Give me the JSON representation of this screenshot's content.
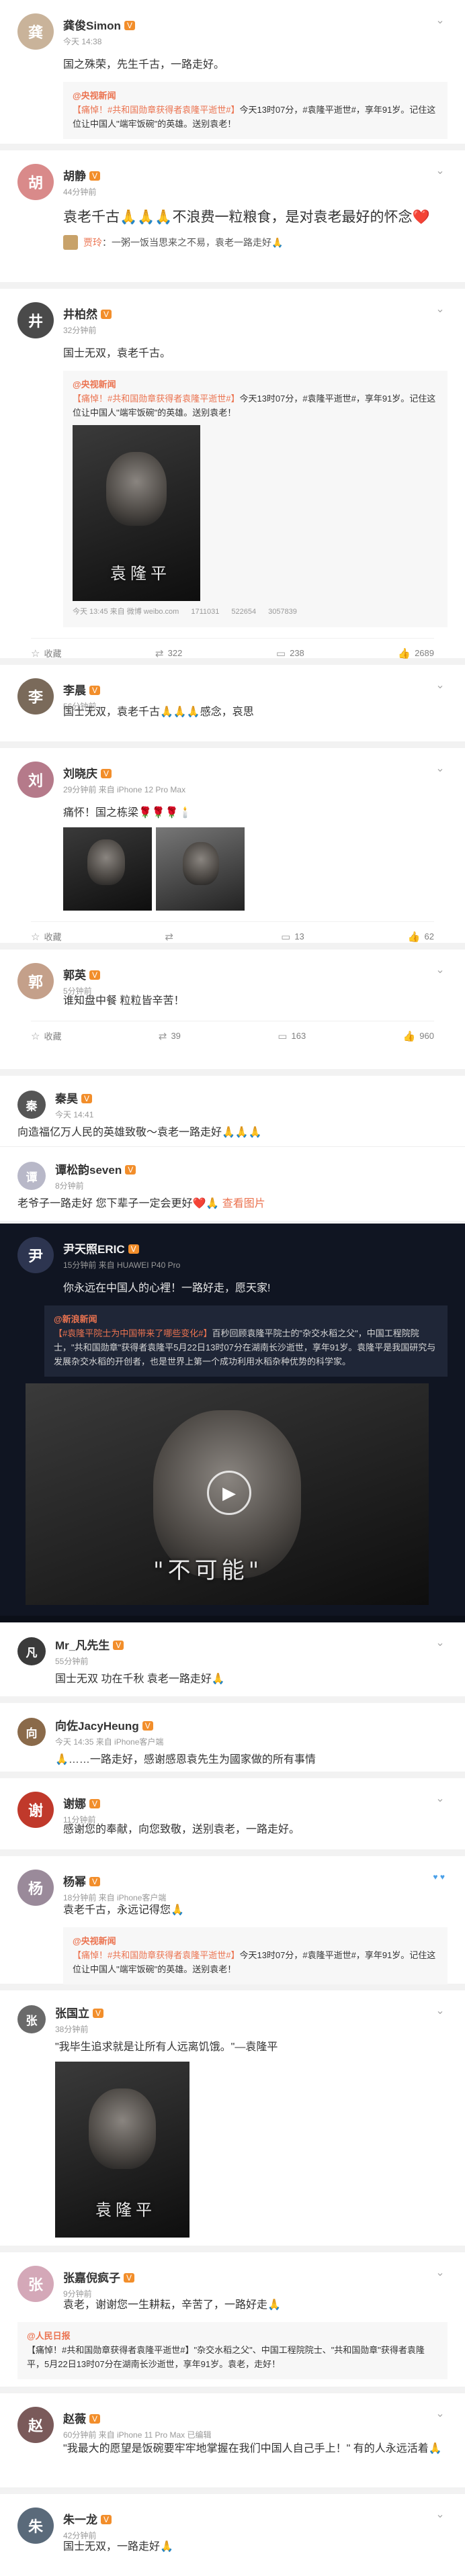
{
  "p1": {
    "name": "龚俊Simon",
    "meta": "今天 14:38",
    "text": "国之殊荣，先生千古，一路走好。",
    "q_name": "@央视新闻",
    "q_tag": "【痛悼！#共和国勋章获得者袁隆平逝世#】",
    "q_body": "今天13时07分，#袁隆平逝世#，享年91岁。记住这位让中国人\"端牢饭碗\"的英雄。送别袁老！"
  },
  "p2": {
    "name": "胡静",
    "meta": "44分钟前",
    "text": "袁老千古🙏🙏🙏不浪费一粒粮食，是对袁老最好的怀念❤️",
    "reply_name": "贾玲",
    "reply": "一粥一饭当思来之不易，袁老一路走好🙏"
  },
  "p3": {
    "name": "井柏然",
    "meta": "32分钟前",
    "text": "国士无双，袁老千古。",
    "q_name": "@央视新闻",
    "q_tag": "【痛悼！#共和国勋章获得者袁隆平逝世#】",
    "q_body": "今天13时07分，#袁隆平逝世#，享年91岁。记住这位让中国人\"端牢饭碗\"的英雄。送别袁老！",
    "q_caption": "袁隆平",
    "q_meta": [
      "今天 13:45 来自 微博 weibo.com",
      "1711031",
      "522654",
      "3057839"
    ],
    "actions": [
      "收藏",
      "322",
      "238",
      "2689"
    ]
  },
  "p4": {
    "name": "李晨",
    "meta": "56分钟前",
    "text": "国士无双，袁老千古🙏🙏🙏感念，哀思"
  },
  "p5": {
    "name": "刘晓庆",
    "meta": "29分钟前 来自 iPhone 12 Pro Max",
    "text": "痛怀！国之栋梁🌹🌹🌹🕯️",
    "actions": [
      "收藏",
      "",
      "13",
      "62"
    ]
  },
  "p6": {
    "name": "郭英",
    "meta": "5分钟前",
    "text": "谁知盘中餐 粒粒皆辛苦！",
    "actions": [
      "收藏",
      "39",
      "163",
      "960"
    ]
  },
  "p7": {
    "name": "秦昊",
    "meta": "今天 14:41",
    "text": "向造福亿万人民的英雄致敬～袁老一路走好🙏🙏🙏"
  },
  "p8": {
    "name": "谭松韵seven",
    "meta": "8分钟前",
    "text": "老爷子一路走好 您下辈子一定会更好❤️🙏",
    "img_link": "查看图片"
  },
  "p9": {
    "name": "尹天照ERIC",
    "meta": "15分钟前 来自 HUAWEI P40 Pro",
    "text": "你永远在中国人的心裡！一路好走，愿天家!",
    "q_name": "@新浪新闻",
    "q_tag": "【#袁隆平院士为中国带来了哪些变化#】",
    "q_body": "百秒回顾袁隆平院士的\"杂交水稻之父\"，中国工程院院士，\"共和国勋章\"获得者袁隆平5月22日13时07分在湖南长沙逝世，享年91岁。袁隆平是我国研究与发展杂交水稻的开创者，也是世界上第一个成功利用水稻杂种优势的科学家。",
    "video_caption": "\"不可能\""
  },
  "p10": {
    "name": "Mr_凡先生",
    "meta": "55分钟前",
    "text": "国士无双 功在千秋 袁老一路走好🙏"
  },
  "p11": {
    "name": "向佐JacyHeung",
    "meta": "今天 14:35 来自 iPhone客户端",
    "text": "🙏……一路走好，感谢感恩袁先生为國家做的所有事情"
  },
  "p12": {
    "name": "谢娜",
    "meta": "11分钟前",
    "text": "感谢您的奉献，向您致敬，送别袁老，一路走好。"
  },
  "p13": {
    "name": "杨幂",
    "meta": "18分钟前 来自 iPhone客户端",
    "text": "袁老千古，永远记得您🙏",
    "q_name": "@央视新闻",
    "q_tag": "【痛悼！#共和国勋章获得者袁隆平逝世#】",
    "q_body": "今天13时07分，#袁隆平逝世#，享年91岁。记住这位让中国人\"端牢饭碗\"的英雄。送别袁老！"
  },
  "p14": {
    "name": "张国立",
    "meta": "38分钟前",
    "text": "\"我毕生追求就是让所有人远离饥饿。\"—袁隆平",
    "photo_caption": "袁隆平"
  },
  "p15": {
    "name": "张嘉倪疯子",
    "meta": "9分钟前",
    "text": "袁老，谢谢您一生耕耘，辛苦了，一路好走🙏",
    "q_name": "@人民日报",
    "q_body": "【痛悼！#共和国勋章获得者袁隆平逝世#】\"杂交水稻之父\"、中国工程院院士、\"共和国勋章\"获得者袁隆平，5月22日13时07分在湖南长沙逝世，享年91岁。袁老，走好！"
  },
  "p16": {
    "name": "赵薇",
    "meta": "60分钟前 来自 iPhone 11 Pro Max 已编辑",
    "text": "\"我最大的愿望是饭碗要牢牢地掌握在我们中国人自己手上！\" 有的人永远活着🙏"
  },
  "p17": {
    "name": "朱一龙",
    "meta": "42分钟前",
    "text": "国士无双，一路走好🙏"
  },
  "badge": "V"
}
